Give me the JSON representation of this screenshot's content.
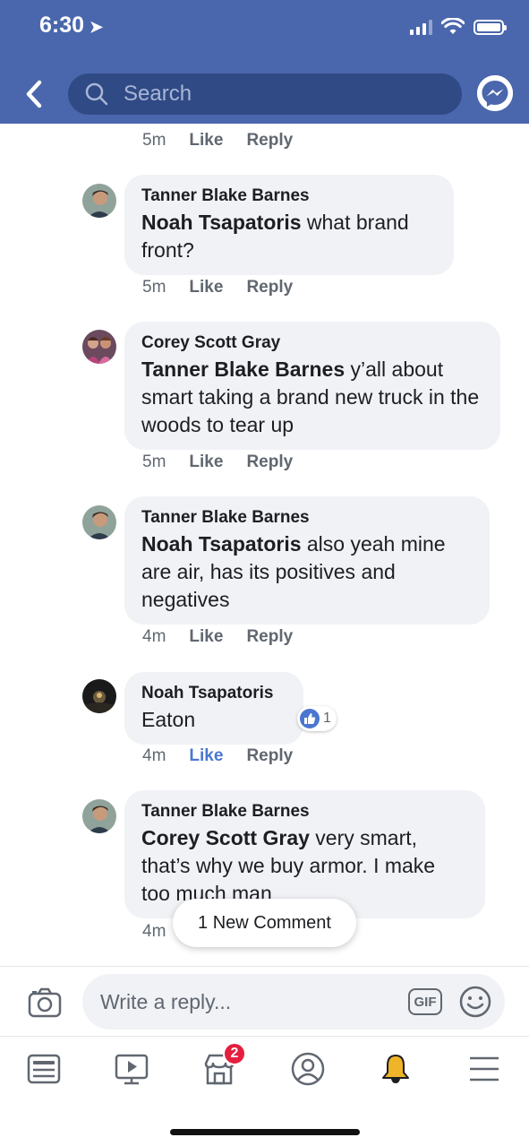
{
  "status_bar": {
    "time": "6:30"
  },
  "header": {
    "search_placeholder": "Search"
  },
  "comments": [
    {
      "time": "5m",
      "like": "Like",
      "reply": "Reply"
    },
    {
      "author": "Tanner Blake Barnes",
      "mention": "Noah Tsapatoris",
      "text": " what brand front?",
      "time": "5m",
      "like": "Like",
      "reply": "Reply"
    },
    {
      "author": "Corey Scott Gray",
      "mention": "Tanner Blake Barnes",
      "text": " y’all about smart taking a brand new truck in the woods to tear up",
      "time": "5m",
      "like": "Like",
      "reply": "Reply"
    },
    {
      "author": "Tanner Blake Barnes",
      "mention": "Noah Tsapatoris",
      "text": " also yeah mine are air, has its positives and negatives",
      "time": "4m",
      "like": "Like",
      "reply": "Reply"
    },
    {
      "author": "Noah Tsapatoris",
      "text": "Eaton",
      "time": "4m",
      "like": "Like",
      "reply": "Reply",
      "reaction_count": "1"
    },
    {
      "author": "Tanner Blake Barnes",
      "mention": "Corey Scott Gray",
      "text": " very smart, that’s why we buy armor. I make too much man",
      "time": "4m"
    }
  ],
  "new_comment_label": "1 New Comment",
  "reply_bar": {
    "placeholder": "Write a reply...",
    "gif_label": "GIF"
  },
  "tab_bar": {
    "marketplace_badge": "2"
  },
  "colors": {
    "header": "#4a67ad",
    "search_box": "#2f4a85",
    "bubble": "#f0f2f5",
    "liked": "#4a76d1",
    "badge": "#e41e3f",
    "notification_bell": "#f0b429"
  }
}
